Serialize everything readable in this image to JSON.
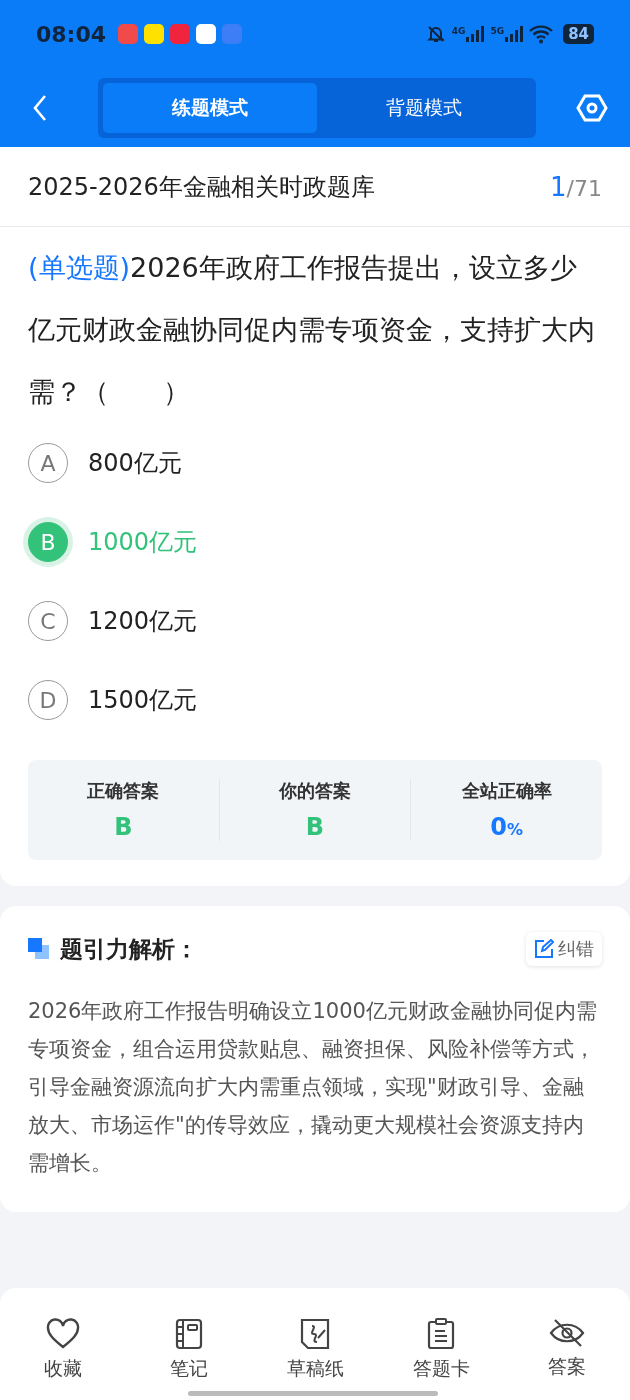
{
  "status_bar": {
    "time": "08:04",
    "battery": "84",
    "network_labels": [
      "4G",
      "5G"
    ]
  },
  "header": {
    "tabs": [
      {
        "label": "练题模式",
        "selected": true
      },
      {
        "label": "背题模式",
        "selected": false
      }
    ]
  },
  "title_row": {
    "title": "2025-2026年金融相关时政题库",
    "current": "1",
    "total": "/71"
  },
  "question": {
    "type": "(单选题)",
    "text": "2026年政府工作报告提出，设立多少亿元财政金融协同促内需专项资金，支持扩大内需？（　　）"
  },
  "options": [
    {
      "letter": "A",
      "text": "800亿元",
      "selected": false
    },
    {
      "letter": "B",
      "text": "1000亿元",
      "selected": true
    },
    {
      "letter": "C",
      "text": "1200亿元",
      "selected": false
    },
    {
      "letter": "D",
      "text": "1500亿元",
      "selected": false
    }
  ],
  "stats": [
    {
      "label": "正确答案",
      "value": "B",
      "kind": "answer"
    },
    {
      "label": "你的答案",
      "value": "B",
      "kind": "answer"
    },
    {
      "label": "全站正确率",
      "value": "0",
      "unit": "%",
      "kind": "rate"
    }
  ],
  "analysis": {
    "title": "题引力解析：",
    "report_button": "纠错",
    "text": "2026年政府工作报告明确设立1000亿元财政金融协同促内需专项资金，组合运用贷款贴息、融资担保、风险补偿等方式，引导金融资源流向扩大内需重点领域，实现\"财政引导、金融放大、市场运作\"的传导效应，撬动更大规模社会资源支持内需增长。"
  },
  "bottom_bar": [
    {
      "label": "收藏",
      "kind": "heart"
    },
    {
      "label": "笔记",
      "kind": "notebook"
    },
    {
      "label": "草稿纸",
      "kind": "draft"
    },
    {
      "label": "答题卡",
      "kind": "clipboard"
    },
    {
      "label": "答案",
      "kind": "eye"
    }
  ]
}
